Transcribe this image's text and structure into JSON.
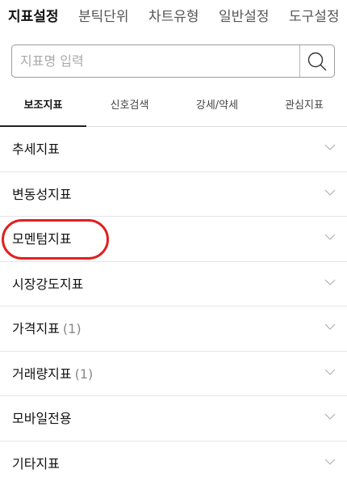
{
  "top_tabs": [
    {
      "label": "지표설정",
      "active": true
    },
    {
      "label": "분틱단위",
      "active": false
    },
    {
      "label": "차트유형",
      "active": false
    },
    {
      "label": "일반설정",
      "active": false
    },
    {
      "label": "도구설정",
      "active": false
    }
  ],
  "search": {
    "placeholder": "지표명 입력",
    "value": ""
  },
  "sub_tabs": [
    {
      "label": "보조지표",
      "active": true
    },
    {
      "label": "신호검색",
      "active": false
    },
    {
      "label": "강세/약세",
      "active": false
    },
    {
      "label": "관심지표",
      "active": false
    }
  ],
  "categories": [
    {
      "label": "추세지표",
      "count": ""
    },
    {
      "label": "변동성지표",
      "count": ""
    },
    {
      "label": "모멘텀지표",
      "count": "",
      "highlighted": true
    },
    {
      "label": "시장강도지표",
      "count": ""
    },
    {
      "label": "가격지표",
      "count": "(1)"
    },
    {
      "label": "거래량지표",
      "count": "(1)"
    },
    {
      "label": "모바일전용",
      "count": ""
    },
    {
      "label": "기타지표",
      "count": ""
    }
  ],
  "icons": {
    "search": "search-icon",
    "expand": "chevron-down-icon"
  },
  "colors": {
    "highlight": "#e02020"
  }
}
